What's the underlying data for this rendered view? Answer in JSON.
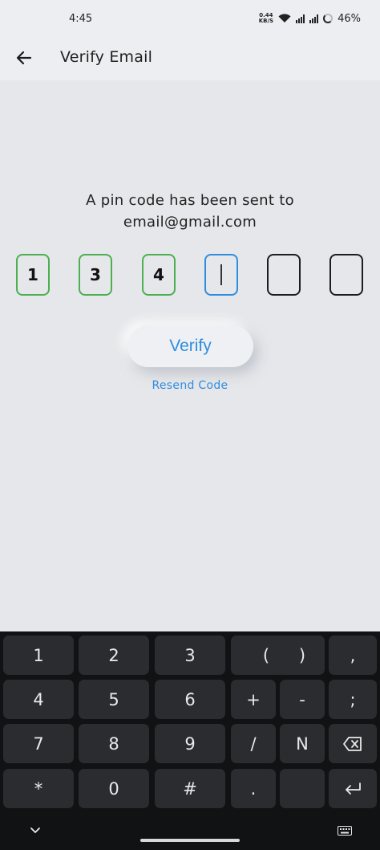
{
  "status_bar": {
    "time": "4:45",
    "net_speed_value": "0.44",
    "net_speed_unit": "KB/S",
    "battery": "46%"
  },
  "app_bar": {
    "back_icon": "arrow-left-icon",
    "title": "Verify Email"
  },
  "content": {
    "message_line1": "A pin code has been sent to",
    "message_line2": "email@gmail.com",
    "pin_digits": [
      "1",
      "3",
      "4",
      "",
      "",
      ""
    ],
    "verify_label": "Verify",
    "resend_label": "Resend Code"
  },
  "colors": {
    "accent": "#2f8de0",
    "filled_border": "#4caf50",
    "background": "#e6e7ea"
  },
  "keyboard": {
    "rows": [
      [
        "1",
        "2",
        "3",
        "(",
        ")",
        ","
      ],
      [
        "4",
        "5",
        "6",
        "+",
        "-",
        ";"
      ],
      [
        "7",
        "8",
        "9",
        "/",
        "N",
        "backspace-icon"
      ],
      [
        "*",
        "0",
        "#",
        ".",
        "",
        "enter-icon"
      ]
    ]
  }
}
